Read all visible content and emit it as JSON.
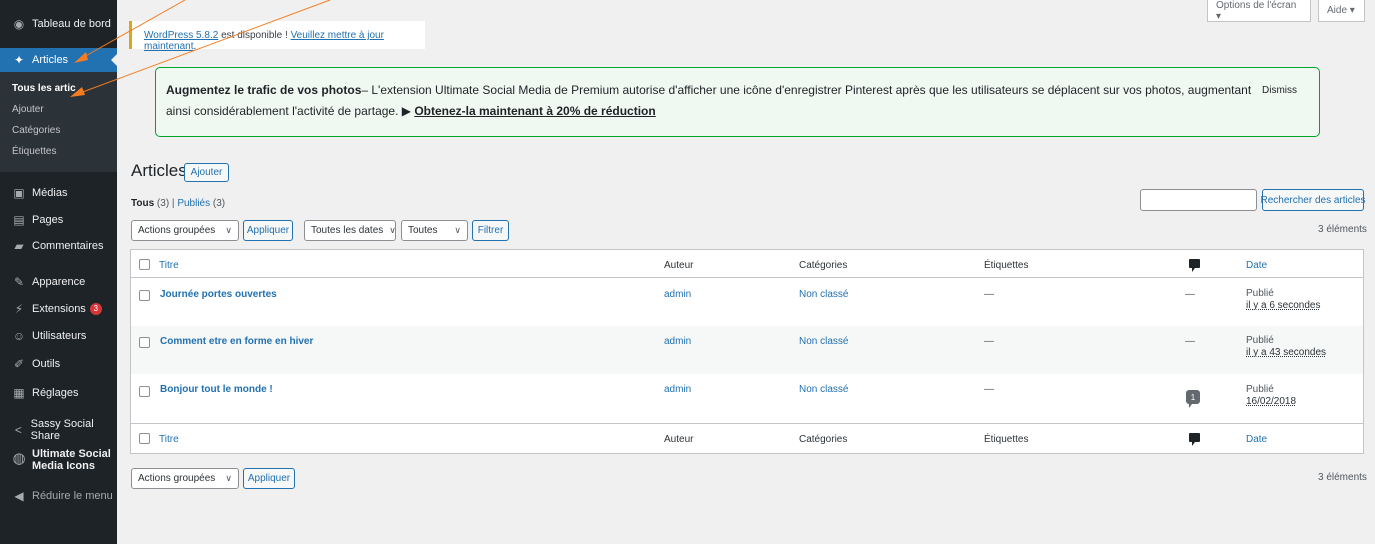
{
  "sidebar": {
    "dashboard": "Tableau de bord",
    "articles": "Articles",
    "sub_items": [
      "Tous les artic",
      "Ajouter",
      "Catégories",
      "Étiquettes"
    ],
    "media": "Médias",
    "pages": "Pages",
    "comments": "Commentaires",
    "appearance": "Apparence",
    "extensions": "Extensions",
    "extensions_badge": "3",
    "users": "Utilisateurs",
    "tools": "Outils",
    "settings": "Réglages",
    "sassy": "Sassy Social Share",
    "usm_line1": "Ultimate Social",
    "usm_line2": "Media Icons",
    "collapse": "Réduire le menu"
  },
  "top": {
    "screen_options": "Options de l'écran ▾",
    "help": "Aide ▾"
  },
  "update_notice": {
    "link1": "WordPress 5.8.2",
    "mid": " est disponible ! ",
    "link2": "Veuillez mettre à jour maintenant",
    "end": "."
  },
  "promo": {
    "bold": "Augmentez le trafic de vos photos",
    "text": "– L'extension Ultimate Social Media de Premium autorise d'afficher une icône d'enregistrer Pinterest après que les utilisateurs se déplacent sur vos photos, augmentant ainsi considérablement l'activité de partage. ▶ ",
    "cta": "Obtenez-la maintenant à 20% de réduction",
    "dismiss": "Dismiss"
  },
  "heading": {
    "title": "Articles",
    "add_button": "Ajouter"
  },
  "filters": {
    "all": "Tous",
    "all_count": " (3)",
    "sep": " | ",
    "published": "Publiés",
    "published_count": " (3)"
  },
  "search": {
    "placeholder": "",
    "button": "Rechercher des articles"
  },
  "toolbar_top": {
    "bulk": "Actions groupées",
    "apply": "Appliquer",
    "dates": "Toutes les dates",
    "cats": "Toutes",
    "filter": "Filtrer",
    "count": "3 éléments"
  },
  "table": {
    "headers": {
      "title": "Titre",
      "author": "Auteur",
      "categories": "Catégories",
      "tags": "Étiquettes",
      "date": "Date"
    },
    "rows": [
      {
        "title": "Journée portes ouvertes",
        "author": "admin",
        "category": "Non classé",
        "tags": "—",
        "comments": "—",
        "status": "Publié",
        "date": "il y a 6 secondes"
      },
      {
        "title": "Comment etre en forme en hiver",
        "author": "admin",
        "category": "Non classé",
        "tags": "—",
        "comments": "—",
        "status": "Publié",
        "date": "il y a 43 secondes"
      },
      {
        "title": "Bonjour tout le monde !",
        "author": "admin",
        "category": "Non classé",
        "tags": "—",
        "comments": "1",
        "status": "Publié",
        "date": "16/02/2018"
      }
    ]
  },
  "toolbar_bottom": {
    "bulk": "Actions groupées",
    "apply": "Appliquer",
    "count": "3 éléments"
  },
  "colors": {
    "sidebar_bg": "#1d2327",
    "accent": "#2271b1",
    "annotation": "#f57c1f"
  }
}
